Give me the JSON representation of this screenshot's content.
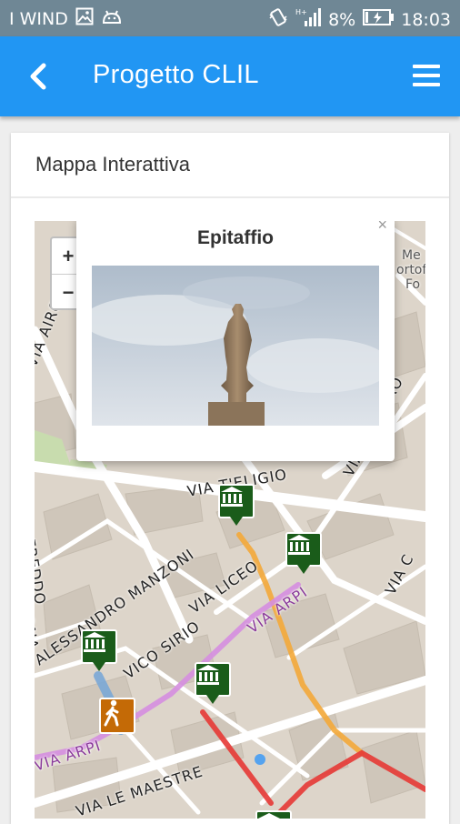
{
  "status_bar": {
    "carrier": "I WIND",
    "signal_label": "H+",
    "battery": "8%",
    "time": "18:03"
  },
  "app_bar": {
    "title": "Progetto CLIL",
    "back_icon": "back-arrow-icon",
    "menu_icon": "hamburger-menu-icon"
  },
  "card": {
    "title": "Mappa Interattiva"
  },
  "map": {
    "zoom_in": "+",
    "zoom_out": "−",
    "popup": {
      "title": "Epitaffio",
      "close": "×"
    },
    "street_labels": [
      "VIA T'ELIGIO",
      "VIA LICEO",
      "VICO SIRIO",
      "ALESSANDRO MANZONI",
      "VIA ARPI",
      "VIA ARPI",
      "VIA LE MAESTRE",
      "VIA AIRONE",
      "VIA CAZZARO",
      "VIA C",
      "FREDDO",
      "CRONA",
      "Me",
      "ortofr",
      "Fo"
    ],
    "markers": [
      "museum-icon",
      "museum-icon",
      "museum-icon",
      "museum-icon",
      "museum-icon"
    ],
    "walker_icon": "pedestrian-icon",
    "colors": {
      "marker": "#1a5c1a",
      "walker": "#c46a06",
      "route_orange": "#f3a93a",
      "route_purple": "#d58ee0",
      "route_red": "#e53935",
      "route_blue": "#7aa7d6",
      "appbar": "#2196f3"
    }
  }
}
